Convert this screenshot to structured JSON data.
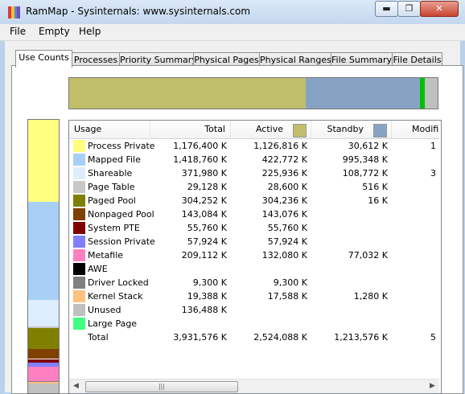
{
  "window": {
    "title": "RamMap - Sysinternals: www.sysinternals.com",
    "controls": {
      "minimize": "▬",
      "maximize": "❐",
      "close": "✕"
    }
  },
  "menu": [
    "File",
    "Empty",
    "Help"
  ],
  "tabs": [
    "Use Counts",
    "Processes",
    "Priority Summary",
    "Physical Pages",
    "Physical Ranges",
    "File Summary",
    "File Details"
  ],
  "active_tab": "Use Counts",
  "columns": {
    "usage": "Usage",
    "total": "Total",
    "active": "Active",
    "standby": "Standby",
    "modified": "Modifie",
    "active_color": "#c1be6c",
    "standby_color": "#86a3c3"
  },
  "rows": [
    {
      "label": "Process Private",
      "color": "#ffff80",
      "total": "1,176,400 K",
      "active": "1,126,816 K",
      "standby": "30,612 K",
      "modified": "1"
    },
    {
      "label": "Mapped File",
      "color": "#a8d0f6",
      "total": "1,418,760 K",
      "active": "422,772 K",
      "standby": "995,348 K",
      "modified": ""
    },
    {
      "label": "Shareable",
      "color": "#dceefe",
      "total": "371,980 K",
      "active": "225,936 K",
      "standby": "108,772 K",
      "modified": "3"
    },
    {
      "label": "Page Table",
      "color": "#c8c8c8",
      "total": "29,128 K",
      "active": "28,600 K",
      "standby": "516 K",
      "modified": ""
    },
    {
      "label": "Paged Pool",
      "color": "#808000",
      "total": "304,252 K",
      "active": "304,236 K",
      "standby": "16 K",
      "modified": ""
    },
    {
      "label": "Nonpaged Pool",
      "color": "#804000",
      "total": "143,084 K",
      "active": "143,076 K",
      "standby": "",
      "modified": ""
    },
    {
      "label": "System PTE",
      "color": "#800000",
      "total": "55,760 K",
      "active": "55,760 K",
      "standby": "",
      "modified": ""
    },
    {
      "label": "Session Private",
      "color": "#8080ff",
      "total": "57,924 K",
      "active": "57,924 K",
      "standby": "",
      "modified": ""
    },
    {
      "label": "Metafile",
      "color": "#ff80c0",
      "total": "209,112 K",
      "active": "132,080 K",
      "standby": "77,032 K",
      "modified": ""
    },
    {
      "label": "AWE",
      "color": "#000000",
      "total": "",
      "active": "",
      "standby": "",
      "modified": ""
    },
    {
      "label": "Driver Locked",
      "color": "#808080",
      "total": "9,300 K",
      "active": "9,300 K",
      "standby": "",
      "modified": ""
    },
    {
      "label": "Kernel Stack",
      "color": "#ffc080",
      "total": "19,388 K",
      "active": "17,588 K",
      "standby": "1,280 K",
      "modified": ""
    },
    {
      "label": "Unused",
      "color": "#c0c0c0",
      "total": "136,488 K",
      "active": "",
      "standby": "",
      "modified": ""
    },
    {
      "label": "Large Page",
      "color": "#40ff80",
      "total": "",
      "active": "",
      "standby": "",
      "modified": ""
    },
    {
      "label": "Total",
      "color": "",
      "total": "3,931,576 K",
      "active": "2,524,088 K",
      "standby": "1,213,576 K",
      "modified": "5"
    }
  ],
  "usage_bar": [
    {
      "name": "Active",
      "color": "#c1be6c",
      "fraction": 0.642
    },
    {
      "name": "Standby",
      "color": "#86a3c3",
      "fraction": 0.309
    },
    {
      "name": "Modified",
      "color": "#00c000",
      "fraction": 0.014
    },
    {
      "name": "Unused",
      "color": "#c0c0c0",
      "fraction": 0.035
    }
  ],
  "vertical_bar": [
    {
      "name": "Process Private",
      "color": "#ffff80",
      "fraction": 0.299
    },
    {
      "name": "Mapped File",
      "color": "#a8d0f6",
      "fraction": 0.361
    },
    {
      "name": "Shareable",
      "color": "#dceefe",
      "fraction": 0.095
    },
    {
      "name": "Page Table",
      "color": "#c8c8c8",
      "fraction": 0.007
    },
    {
      "name": "Paged Pool",
      "color": "#808000",
      "fraction": 0.077
    },
    {
      "name": "Nonpaged Pool",
      "color": "#804000",
      "fraction": 0.036
    },
    {
      "name": "System PTE",
      "color": "#800000",
      "fraction": 0.014
    },
    {
      "name": "Session Private",
      "color": "#8080ff",
      "fraction": 0.015
    },
    {
      "name": "Metafile",
      "color": "#ff80c0",
      "fraction": 0.053
    },
    {
      "name": "Driver Locked",
      "color": "#808080",
      "fraction": 0.002
    },
    {
      "name": "Kernel Stack",
      "color": "#ffc080",
      "fraction": 0.005
    },
    {
      "name": "Unused",
      "color": "#c0c0c0",
      "fraction": 0.035
    }
  ]
}
